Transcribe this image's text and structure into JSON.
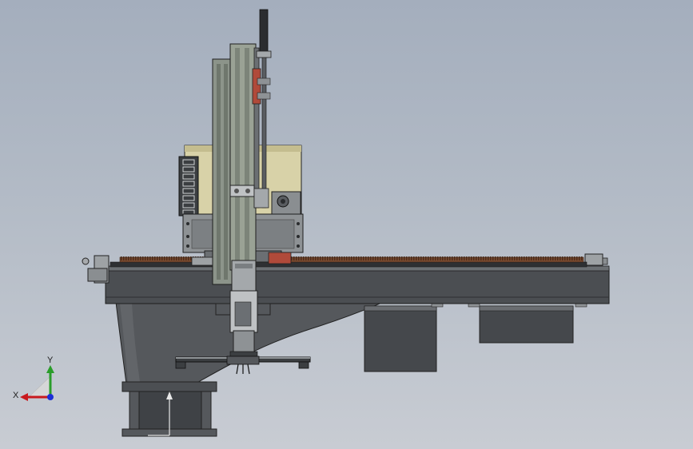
{
  "triad": {
    "x_label": "X",
    "y_label": "Y",
    "x_color": "#c8191e",
    "y_color": "#2a9d2a",
    "z_color": "#1c2fd6"
  },
  "colors": {
    "base_dark": "#4a4d51",
    "base_mid": "#5f6266",
    "frame_gray": "#8e9295",
    "rail_olive": "#9aa295",
    "tan_panel": "#d8d2a8",
    "rack_rust": "#7a4a2f",
    "accent_red": "#b04a3a"
  }
}
